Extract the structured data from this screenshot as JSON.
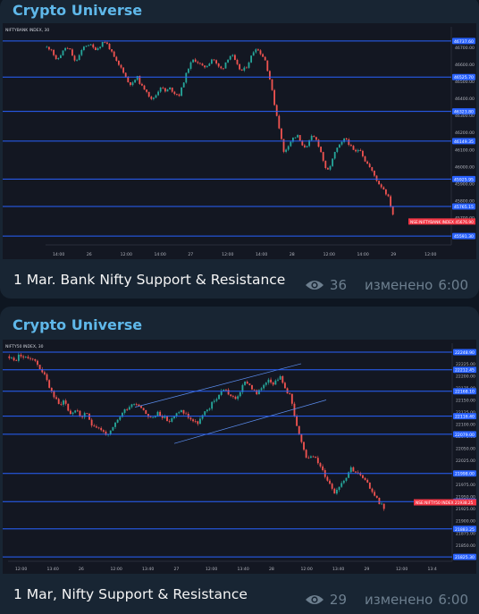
{
  "posts": [
    {
      "channel": "Crypto Universe",
      "caption": "1 Mar. Bank Nifty Support & Resistance",
      "views": "36",
      "edited_label": "изменено",
      "time": "6:00",
      "chart_data": {
        "type": "line",
        "symbol_header": "NIFTYBANK INDEX, 30",
        "current_label": "NSE:NIFTYBANK INDEX",
        "current_value": "45676.90",
        "ylim": [
          45550,
          46800
        ],
        "levels": [
          {
            "value": 46737.6,
            "label": "46737.60"
          },
          {
            "value": 46525.7,
            "label": "46525.70"
          },
          {
            "value": 46323.8,
            "label": "46323.80"
          },
          {
            "value": 46149.35,
            "label": "46149.35"
          },
          {
            "value": 45925.95,
            "label": "45925.95"
          },
          {
            "value": 45765.15,
            "label": "45765.15"
          },
          {
            "value": 45591.3,
            "label": "45591.30"
          }
        ],
        "ytick_labels": [
          "46700.00",
          "46600.00",
          "46500.00",
          "46400.00",
          "46300.00",
          "46200.00",
          "46100.00",
          "46000.00",
          "45900.00",
          "45800.00",
          "45700.00",
          "45600.00"
        ],
        "ytick_values": [
          46700,
          46600,
          46500,
          46400,
          46300,
          46200,
          46100,
          46000,
          45900,
          45800,
          45700,
          45600
        ],
        "xtick_labels": [
          "14:00",
          "26",
          "12:00",
          "14:00",
          "27",
          "12:00",
          "14:00",
          "28",
          "12:00",
          "14:00",
          "29",
          "12:00"
        ],
        "candle_count": 150,
        "close_path": [
          46700,
          46690,
          46620,
          46660,
          46700,
          46680,
          46610,
          46660,
          46710,
          46720,
          46690,
          46700,
          46740,
          46710,
          46650,
          46600,
          46570,
          46500,
          46480,
          46530,
          46470,
          46450,
          46390,
          46420,
          46470,
          46440,
          46460,
          46430,
          46420,
          46510,
          46590,
          46630,
          46610,
          46580,
          46600,
          46640,
          46590,
          46570,
          46630,
          46660,
          46600,
          46560,
          46580,
          46640,
          46700,
          46670,
          46630,
          46520,
          46370,
          46230,
          46080,
          46130,
          46170,
          46180,
          46110,
          46130,
          46180,
          46150,
          46070,
          45960,
          46020,
          46100,
          46130,
          46170,
          46120,
          46080,
          46110,
          46040,
          46000,
          45950,
          45900,
          45870,
          45820,
          45720
        ]
      }
    },
    {
      "channel": "Crypto Universe",
      "caption": "1 Mar, Nifty Support & Resistance",
      "views": "29",
      "edited_label": "изменено",
      "time": "6:00",
      "chart_data": {
        "type": "line",
        "symbol_header": "NIFTY50 INDEX, 30",
        "current_label": "NSE:NIFTY50 INDEX",
        "current_value": "21938.25",
        "ylim": [
          21820,
          22260
        ],
        "levels": [
          {
            "value": 22248.9,
            "label": "22248.90"
          },
          {
            "value": 22212.45,
            "label": "22212.45"
          },
          {
            "value": 22168.1,
            "label": "22168.10"
          },
          {
            "value": 22116.4,
            "label": "22116.40"
          },
          {
            "value": 22079.0,
            "label": "22079.00"
          },
          {
            "value": 21998.0,
            "label": "21998.00"
          },
          {
            "value": 21939.75,
            "label": "21939.75"
          },
          {
            "value": 21883.25,
            "label": "21883.25"
          },
          {
            "value": 21825.3,
            "label": "21825.30"
          }
        ],
        "ytick_labels": [
          "22225.00",
          "22200.00",
          "22175.00",
          "22150.00",
          "22125.00",
          "22100.00",
          "22075.00",
          "22050.00",
          "22025.00",
          "22000.00",
          "21975.00",
          "21950.00",
          "21925.00",
          "21900.00",
          "21875.00",
          "21850.00"
        ],
        "ytick_values": [
          22225,
          22200,
          22175,
          22150,
          22125,
          22100,
          22075,
          22050,
          22025,
          22000,
          21975,
          21950,
          21925,
          21900,
          21875,
          21850
        ],
        "xtick_labels": [
          "12:00",
          "13:40",
          "26",
          "12:00",
          "13:40",
          "27",
          "12:00",
          "13:40",
          "28",
          "12:00",
          "13:40",
          "29",
          "12:00",
          "13:4"
        ],
        "candle_count": 160,
        "close_path": [
          22240,
          22230,
          22245,
          22235,
          22240,
          22225,
          22210,
          22185,
          22160,
          22140,
          22150,
          22120,
          22130,
          22115,
          22120,
          22100,
          22095,
          22085,
          22075,
          22095,
          22115,
          22130,
          22140,
          22145,
          22135,
          22120,
          22110,
          22125,
          22115,
          22105,
          22115,
          22130,
          22120,
          22110,
          22100,
          22115,
          22130,
          22145,
          22160,
          22175,
          22160,
          22150,
          22170,
          22190,
          22175,
          22160,
          22180,
          22195,
          22185,
          22200,
          22175,
          22160,
          22100,
          22060,
          22030,
          22040,
          22020,
          22000,
          21980,
          21960,
          21975,
          21990,
          22010,
          22000,
          21990,
          21975,
          21960,
          21940,
          21928
        ]
      }
    }
  ],
  "colors": {
    "bg": "#0e1621",
    "bubble": "#182533",
    "channel": "#5fb8ea",
    "chart_bg": "#131722",
    "level_line": "#2962ff",
    "level_label_bg": "#2962ff",
    "current_label_bg": "#f23645",
    "bull": "#26a69a",
    "bear": "#ef5350",
    "channel_line": "#5b8def"
  }
}
